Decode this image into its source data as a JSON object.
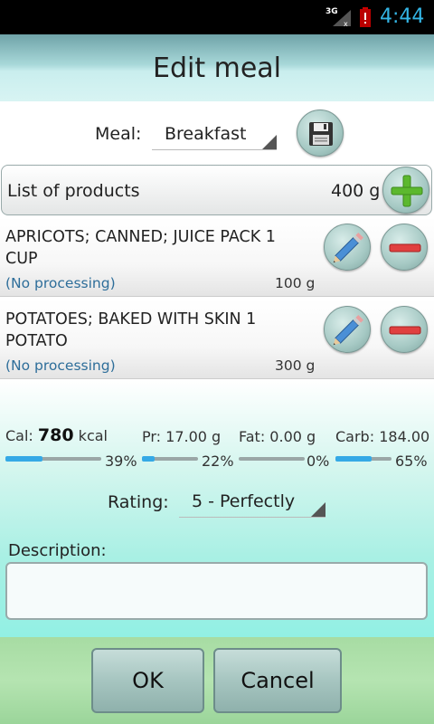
{
  "status_bar": {
    "network": "3G",
    "time": "4:44"
  },
  "header": {
    "title": "Edit meal"
  },
  "meal": {
    "label": "Meal:",
    "selected": "Breakfast"
  },
  "products": {
    "header_label": "List of products",
    "total_weight": "400 g",
    "items": [
      {
        "name": "APRICOTS; CANNED; JUICE PACK 1 CUP",
        "processing": "(No processing)",
        "weight": "100 g"
      },
      {
        "name": "POTATOES; BAKED WITH SKIN 1 POTATO",
        "processing": "(No processing)",
        "weight": "300 g"
      }
    ]
  },
  "nutrition": {
    "cal_label": "Cal:",
    "cal_value": "780",
    "cal_unit": "kcal",
    "cal_pct": "39%",
    "cal_fraction": 0.39,
    "pr_label": "Pr:",
    "pr_value": "17.00 g",
    "pr_pct": "22%",
    "pr_fraction": 0.22,
    "fat_label": "Fat:",
    "fat_value": "0.00 g",
    "fat_pct": "0%",
    "fat_fraction": 0.0,
    "carb_label": "Carb:",
    "carb_value": "184.00",
    "carb_pct": "65%",
    "carb_fraction": 0.65,
    "bar_color": "#35a9e6"
  },
  "rating": {
    "label": "Rating:",
    "selected": "5 - Perfectly"
  },
  "description": {
    "label": "Description:",
    "value": ""
  },
  "buttons": {
    "ok": "OK",
    "cancel": "Cancel"
  },
  "icons": {
    "save": "floppy-disk-icon",
    "add": "plus-icon",
    "edit": "pencil-icon",
    "delete": "minus-icon"
  }
}
